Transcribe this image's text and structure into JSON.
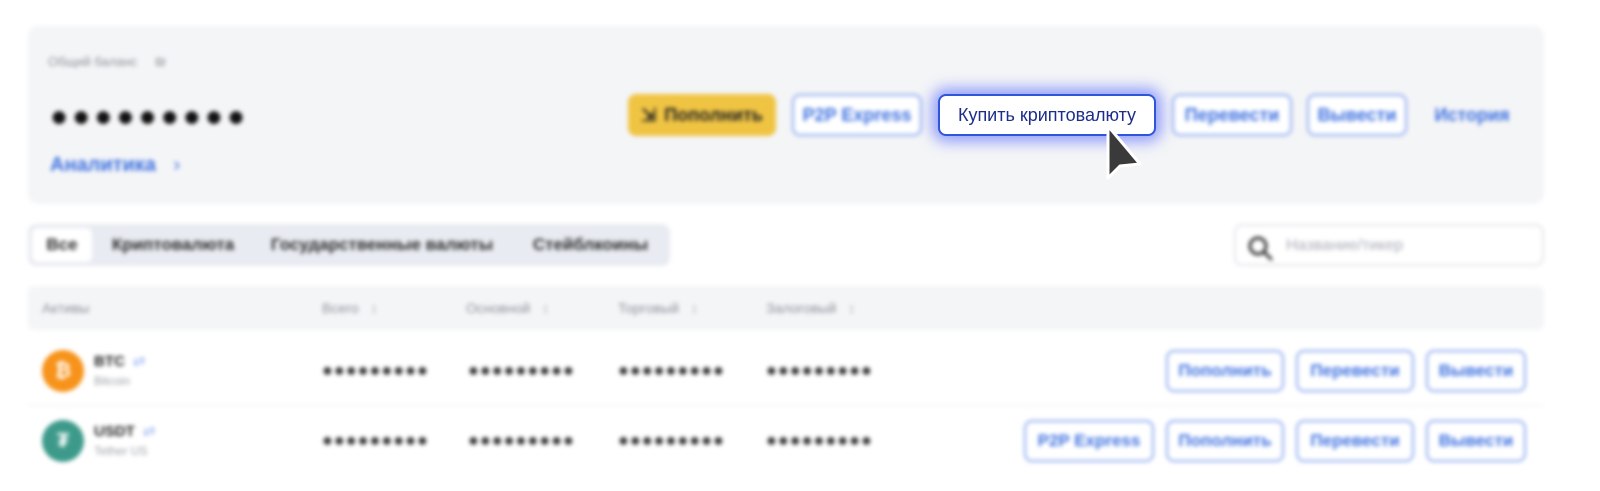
{
  "balance": {
    "label": "Общий баланс",
    "eye_icon": "eye-off-icon",
    "eye_glyph": "₪",
    "value": "●●●●●●●●●",
    "analytics_label": "Аналитика",
    "analytics_chevron": "›"
  },
  "top_actions": {
    "deposit": "Пополнить",
    "deposit_glyph": "⇲",
    "p2p": "P2P Express",
    "buy_crypto": "Купить криптовалюту",
    "transfer": "Перевести",
    "withdraw": "Вывести",
    "history": "История"
  },
  "tabs": [
    "Все",
    "Криптовалюта",
    "Государственные валюты",
    "Стейблкоины"
  ],
  "search": {
    "placeholder": "Название/тикер"
  },
  "table": {
    "headers": {
      "asset": "Активы",
      "total": "Всего",
      "main": "Основной",
      "trading": "Торговый",
      "collateral": "Залоговый",
      "sort_glyph": "↕"
    },
    "rows": [
      {
        "ticker": "BTC",
        "name": "Bitcoin",
        "logo_glyph": "₿",
        "logo_color": "#f7931a",
        "link_glyph": "⇄",
        "total": "●●●●●●●●●",
        "main": "●●●●●●●●●",
        "trading": "●●●●●●●●●",
        "collateral": "●●●●●●●●●",
        "actions": {
          "deposit": "Пополнить",
          "transfer": "Перевести",
          "withdraw": "Вывести"
        }
      },
      {
        "ticker": "USDT",
        "name": "Tether US",
        "logo_glyph": "₮",
        "logo_color": "#3d9a8b",
        "link_glyph": "⇄",
        "total": "●●●●●●●●●",
        "main": "●●●●●●●●●",
        "trading": "●●●●●●●●●",
        "collateral": "●●●●●●●●●",
        "actions": {
          "p2p": "P2P Express",
          "deposit": "Пополнить",
          "transfer": "Перевести",
          "withdraw": "Вывести"
        }
      }
    ]
  },
  "colors": {
    "accent": "#3b6fe0",
    "primary_button": "#f0c443",
    "focus_glow": "#465aff"
  }
}
